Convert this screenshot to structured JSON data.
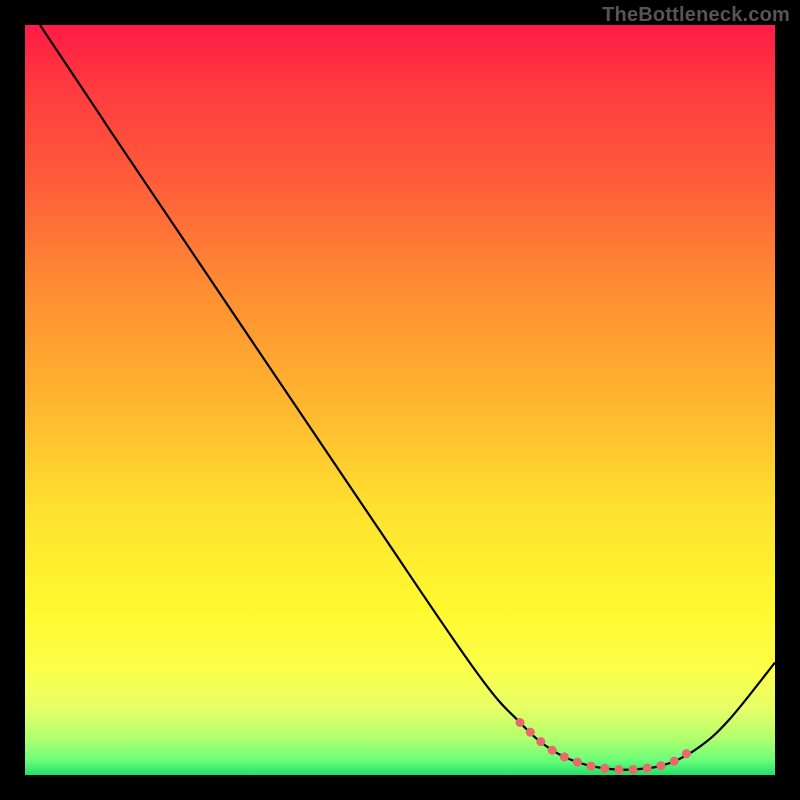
{
  "watermark": "TheBottleneck.com",
  "chart_data": {
    "type": "line",
    "title": "",
    "xlabel": "",
    "ylabel": "",
    "xlim": [
      0,
      100
    ],
    "ylim": [
      0,
      100
    ],
    "series": [
      {
        "name": "curve",
        "color": "#000000",
        "width": 2.2,
        "points": [
          {
            "x": 2,
            "y": 100
          },
          {
            "x": 10,
            "y": 88
          },
          {
            "x": 14,
            "y": 82
          },
          {
            "x": 45,
            "y": 36
          },
          {
            "x": 60,
            "y": 14
          },
          {
            "x": 66,
            "y": 7
          },
          {
            "x": 70,
            "y": 3.5
          },
          {
            "x": 74,
            "y": 1.6
          },
          {
            "x": 78,
            "y": 0.8
          },
          {
            "x": 82,
            "y": 0.8
          },
          {
            "x": 86,
            "y": 1.6
          },
          {
            "x": 90,
            "y": 3.8
          },
          {
            "x": 94,
            "y": 7.5
          },
          {
            "x": 100,
            "y": 15
          }
        ]
      },
      {
        "name": "highlight-segment",
        "color": "#e86a6a",
        "width": 9,
        "linecap": "round",
        "dash": "0.1 14",
        "points": [
          {
            "x": 66,
            "y": 7
          },
          {
            "x": 70,
            "y": 3.5
          },
          {
            "x": 74,
            "y": 1.6
          },
          {
            "x": 78,
            "y": 0.8
          },
          {
            "x": 82,
            "y": 0.8
          },
          {
            "x": 86,
            "y": 1.6
          },
          {
            "x": 89,
            "y": 3.4
          }
        ]
      }
    ]
  }
}
